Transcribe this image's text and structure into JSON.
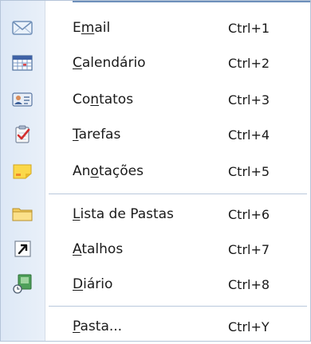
{
  "menu": {
    "items": [
      {
        "id": "email",
        "pre": "E",
        "acc": "m",
        "post": "ail",
        "shortcut": "Ctrl+1",
        "icon": "envelope-icon"
      },
      {
        "id": "calendario",
        "pre": "",
        "acc": "C",
        "post": "alendário",
        "shortcut": "Ctrl+2",
        "icon": "calendar-icon"
      },
      {
        "id": "contatos",
        "pre": "Co",
        "acc": "n",
        "post": "tatos",
        "shortcut": "Ctrl+3",
        "icon": "contact-card-icon"
      },
      {
        "id": "tarefas",
        "pre": "",
        "acc": "T",
        "post": "arefas",
        "shortcut": "Ctrl+4",
        "icon": "task-clipboard-icon"
      },
      {
        "id": "anotacoes",
        "pre": "An",
        "acc": "o",
        "post": "tações",
        "shortcut": "Ctrl+5",
        "icon": "sticky-note-icon"
      },
      {
        "id": "lista-de-pastas",
        "pre": "",
        "acc": "L",
        "post": "ista de Pastas",
        "shortcut": "Ctrl+6",
        "icon": "folder-icon"
      },
      {
        "id": "atalhos",
        "pre": "",
        "acc": "A",
        "post": "talhos",
        "shortcut": "Ctrl+7",
        "icon": "shortcut-arrow-icon"
      },
      {
        "id": "diario",
        "pre": "",
        "acc": "D",
        "post": "iário",
        "shortcut": "Ctrl+8",
        "icon": "journal-icon"
      },
      {
        "id": "pasta",
        "pre": "",
        "acc": "P",
        "post": "asta...",
        "shortcut": "Ctrl+Y",
        "icon": ""
      }
    ]
  },
  "colors": {
    "border": "#b4c4d8",
    "gutter": "#dde8f6",
    "separator": "#b9c8dc"
  }
}
